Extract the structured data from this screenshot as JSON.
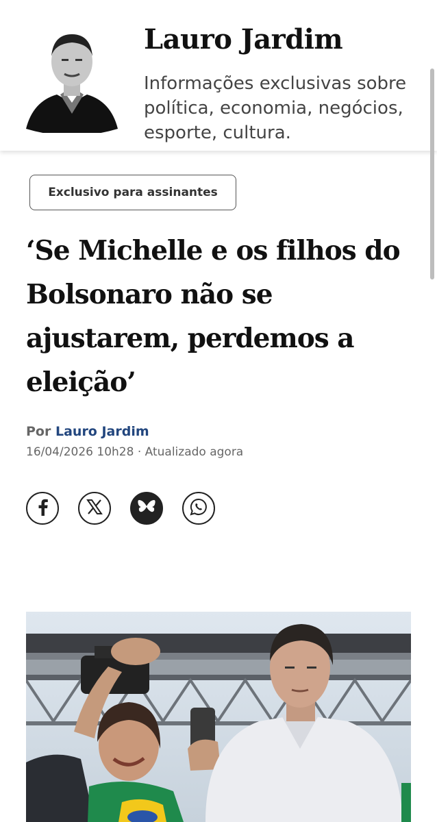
{
  "column": {
    "title": "Lauro Jardim",
    "description": "Informações exclusivas sobre política, economia, negócios, esporte, cultura."
  },
  "article": {
    "badge": "Exclusivo para assinantes",
    "headline": "‘Se Michelle e os filhos do Bolsonaro não se ajustarem, perdemos a eleição’",
    "byline_prefix": "Por",
    "author": "Lauro Jardim",
    "date": "16/04/2026 10h28 · Atualizado agora"
  },
  "share": [
    {
      "icon": "facebook-icon"
    },
    {
      "icon": "x-icon"
    },
    {
      "icon": "bluesky-icon"
    },
    {
      "icon": "whatsapp-icon"
    }
  ],
  "colors": {
    "author_link": "#22467e",
    "text_primary": "#111111",
    "text_secondary": "#666666"
  }
}
